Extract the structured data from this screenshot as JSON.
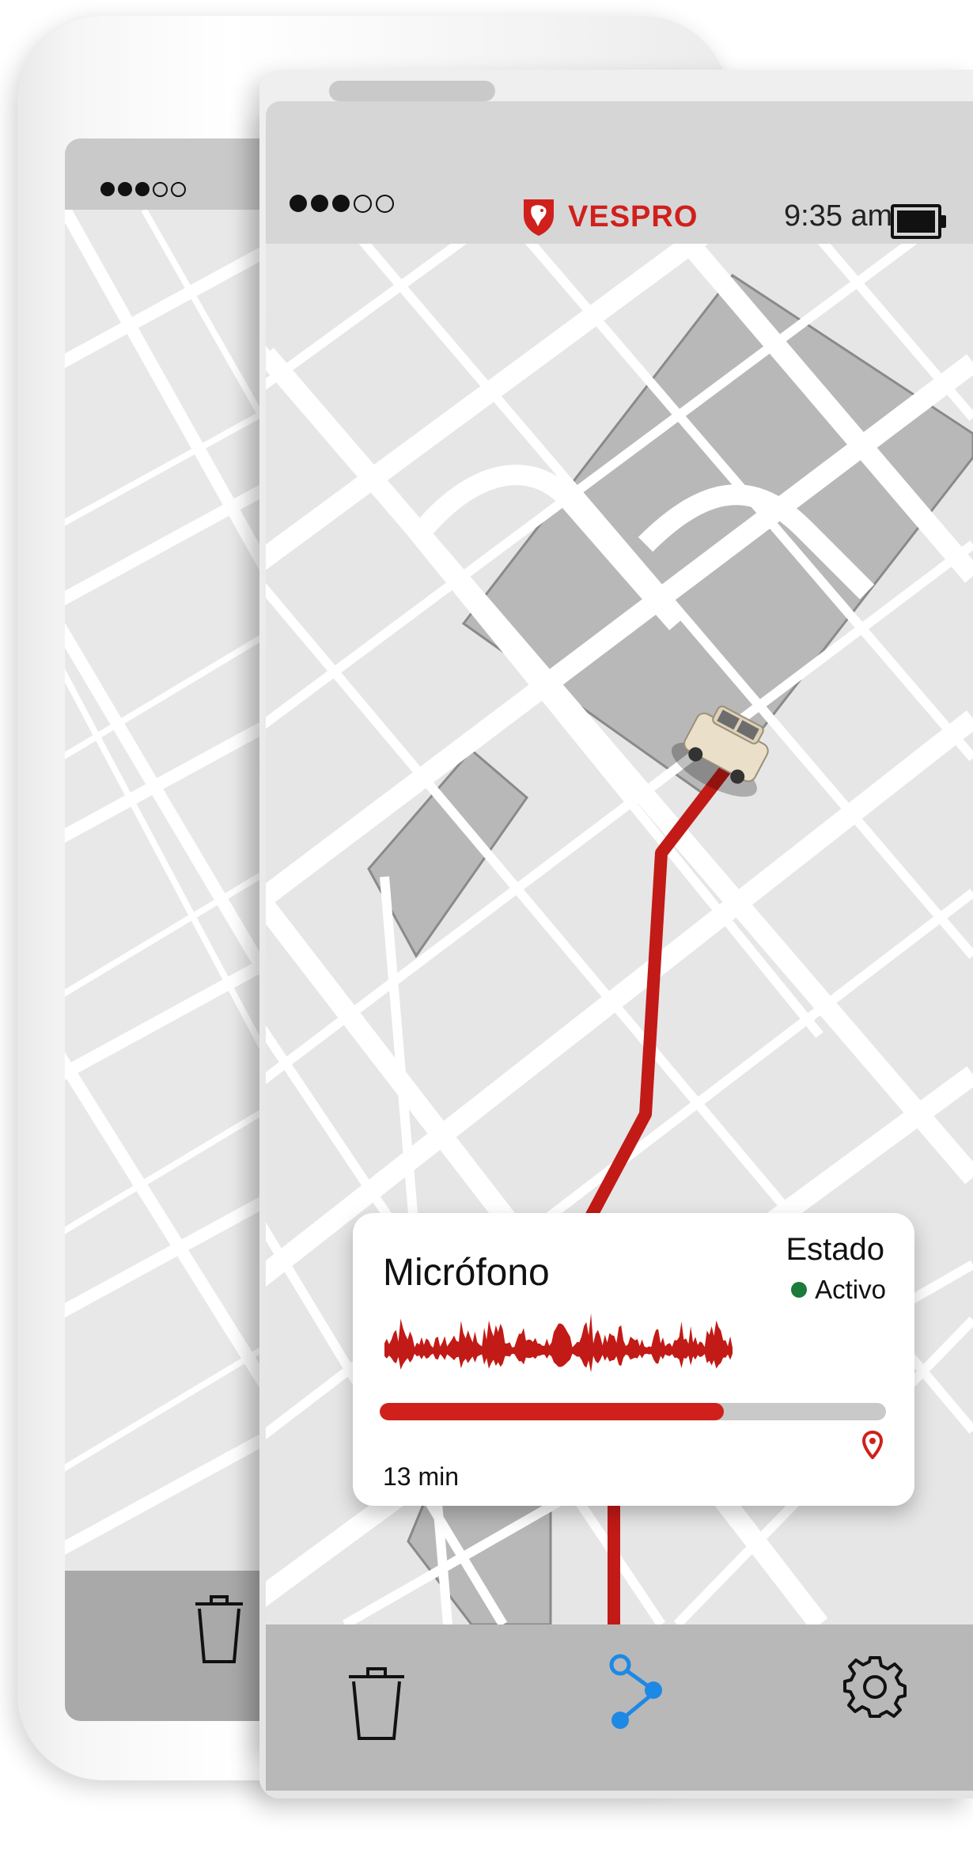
{
  "app": {
    "brand_name": "VESPRO",
    "brand_color": "#d0201b"
  },
  "status_bar": {
    "time": "9:35 am",
    "signal_icon": "signal-dots-icon",
    "battery_icon": "battery-icon"
  },
  "card": {
    "title": "Micrófono",
    "estado_label": "Estado",
    "estado_value": "Activo",
    "estado_color": "#1c7a3a",
    "progress": 0.68,
    "duration": "13 min",
    "waveform_icon": "audio-waveform-icon",
    "location_icon": "location-pin-icon"
  },
  "nav": {
    "items": [
      {
        "icon": "trash-icon",
        "active": false
      },
      {
        "icon": "share-route-icon",
        "active": true
      },
      {
        "icon": "gear-icon",
        "active": false
      }
    ],
    "active_color": "#1e88e5"
  }
}
